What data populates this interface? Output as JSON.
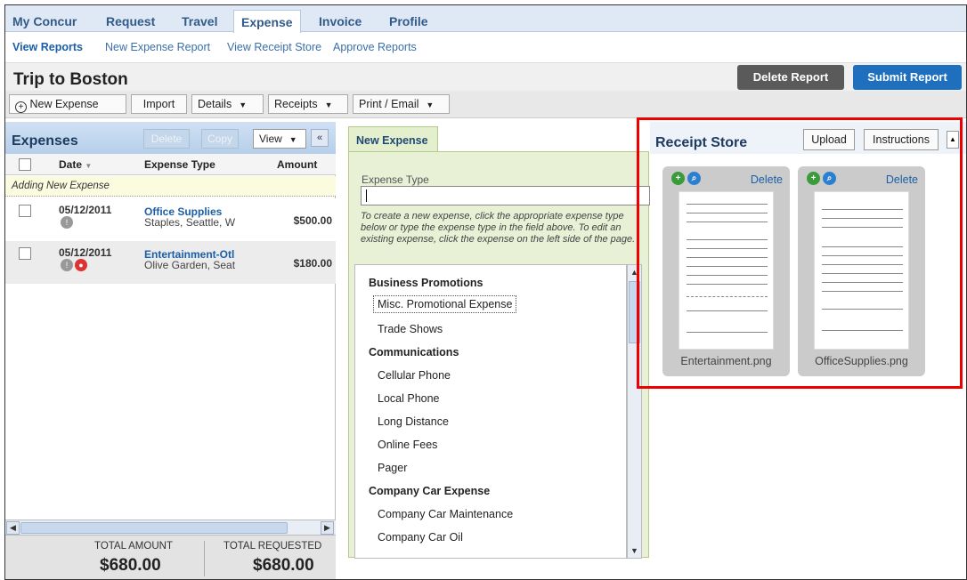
{
  "topnav": {
    "items": [
      "My Concur",
      "Request",
      "Travel",
      "Expense",
      "Invoice",
      "Profile"
    ],
    "active": "Expense"
  },
  "subnav": {
    "items": [
      "View Reports",
      "New Expense Report",
      "View Receipt Store",
      "Approve Reports"
    ]
  },
  "report": {
    "title": "Trip to Boston",
    "delete_label": "Delete Report",
    "submit_label": "Submit Report"
  },
  "toolbar": {
    "new_expense": "New Expense",
    "import": "Import",
    "details": "Details",
    "receipts": "Receipts",
    "print_email": "Print / Email"
  },
  "expenses": {
    "title": "Expenses",
    "delete": "Delete",
    "copy": "Copy",
    "view": "View",
    "columns": {
      "date": "Date",
      "type": "Expense Type",
      "amount": "Amount"
    },
    "adding": "Adding New Expense",
    "rows": [
      {
        "date": "05/12/2011",
        "type": "Office Supplies",
        "vendor": "Staples, Seattle, W",
        "amount": "$500.00"
      },
      {
        "date": "05/12/2011",
        "type": "Entertainment-Otl",
        "vendor": "Olive Garden, Seat",
        "amount": "$180.00"
      }
    ],
    "total_amount_label": "TOTAL AMOUNT",
    "total_amount": "$680.00",
    "total_requested_label": "TOTAL REQUESTED",
    "total_requested": "$680.00"
  },
  "new_expense": {
    "tab": "New Expense",
    "field_label": "Expense Type",
    "field_value": "",
    "help": "To create a new expense, click the appropriate expense type below or type the expense type in the field above. To edit an existing expense, click the expense on the left side of the page.",
    "list": [
      {
        "kind": "cat",
        "label": "Business Promotions"
      },
      {
        "kind": "item",
        "label": "Misc. Promotional Expense",
        "selected": true
      },
      {
        "kind": "item",
        "label": "Trade Shows"
      },
      {
        "kind": "cat",
        "label": "Communications"
      },
      {
        "kind": "item",
        "label": "Cellular Phone"
      },
      {
        "kind": "item",
        "label": "Local Phone"
      },
      {
        "kind": "item",
        "label": "Long Distance"
      },
      {
        "kind": "item",
        "label": "Online Fees"
      },
      {
        "kind": "item",
        "label": "Pager"
      },
      {
        "kind": "cat",
        "label": "Company Car Expense"
      },
      {
        "kind": "item",
        "label": "Company Car Maintenance"
      },
      {
        "kind": "item",
        "label": "Company Car Oil"
      }
    ]
  },
  "receipt_store": {
    "title": "Receipt Store",
    "upload": "Upload",
    "instructions": "Instructions",
    "cards": [
      {
        "delete": "Delete",
        "name": "Entertainment.png"
      },
      {
        "delete": "Delete",
        "name": "OfficeSupplies.png"
      }
    ]
  },
  "colors": {
    "accent_blue": "#1f6fbf",
    "highlight_red": "#ee0000"
  }
}
